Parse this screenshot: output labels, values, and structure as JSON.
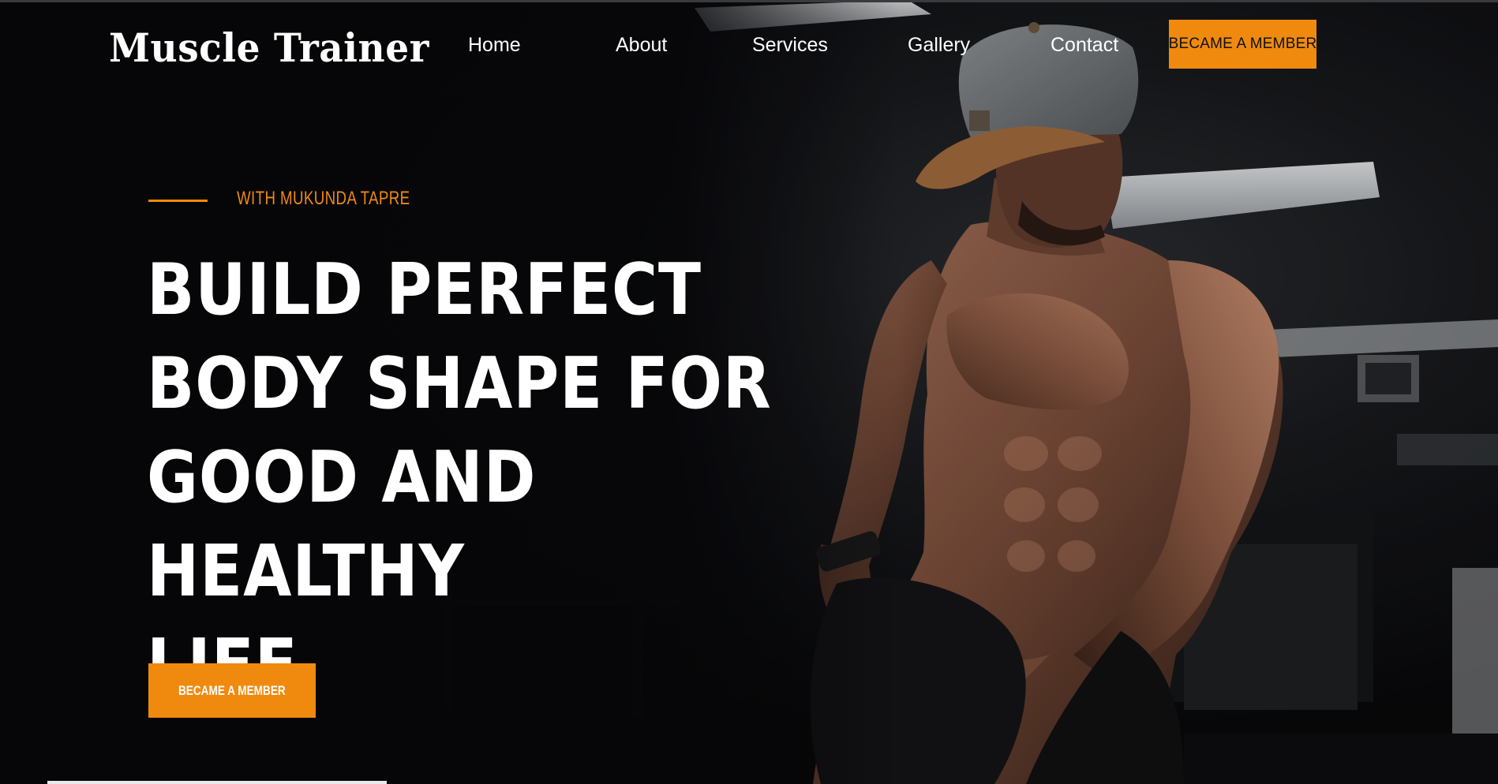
{
  "brand": {
    "logo": "Muscle Trainer"
  },
  "nav": {
    "items": [
      {
        "label": "Home"
      },
      {
        "label": "About"
      },
      {
        "label": "Services"
      },
      {
        "label": "Gallery"
      },
      {
        "label": "Contact"
      }
    ],
    "cta_label": "BECAME A MEMBER"
  },
  "hero": {
    "tagline": "WITH MUKUNDA TAPRE",
    "headline_lines": [
      "BUILD PERFECT",
      "BODY SHAPE FOR",
      "GOOD AND HEALTHY",
      "LIFE."
    ],
    "cta_label": "BECAME A MEMBER"
  },
  "colors": {
    "accent": "#ef8a0f",
    "background": "#0b0b0d",
    "text": "#ffffff"
  },
  "icons": {
    "hero_image": "athlete-photo"
  }
}
